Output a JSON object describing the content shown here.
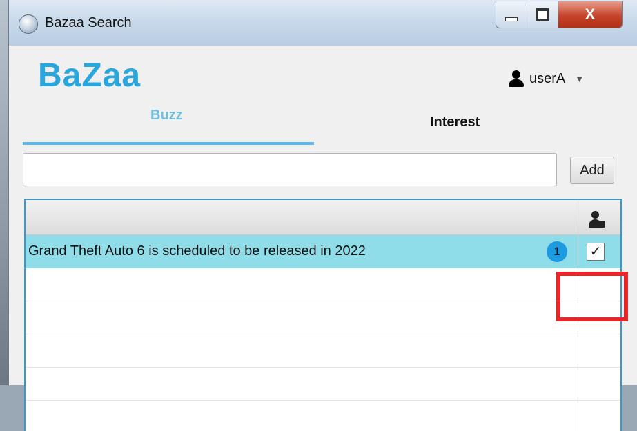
{
  "window": {
    "title": "Bazaa Search",
    "close_glyph": "X",
    "minimize_icon": "minimize-icon",
    "maximize_icon": "maximize-icon"
  },
  "header": {
    "logo": "BaZaa",
    "user": "userA",
    "user_icon": "user-icon",
    "dropdown_icon": "chevron-down-icon"
  },
  "tabs": [
    {
      "label": "Buzz",
      "active": true
    },
    {
      "label": "Interest",
      "active": false
    }
  ],
  "search": {
    "value": "",
    "placeholder": ""
  },
  "add_button": "Add",
  "table": {
    "header_icon": "user-lock-icon",
    "rows": [
      {
        "text": "Grand Theft Auto 6 is scheduled to be released in 2022",
        "badge": "1",
        "checked": true,
        "check_glyph": "✓",
        "selected": true
      },
      {
        "text": "",
        "badge": "",
        "checked": false
      },
      {
        "text": "",
        "badge": "",
        "checked": false
      },
      {
        "text": "",
        "badge": "",
        "checked": false
      },
      {
        "text": "",
        "badge": "",
        "checked": false
      }
    ]
  },
  "colors": {
    "accent": "#29a6dc",
    "selected_row": "#8edde9",
    "badge": "#1e9be0",
    "highlight": "#e5262a"
  }
}
